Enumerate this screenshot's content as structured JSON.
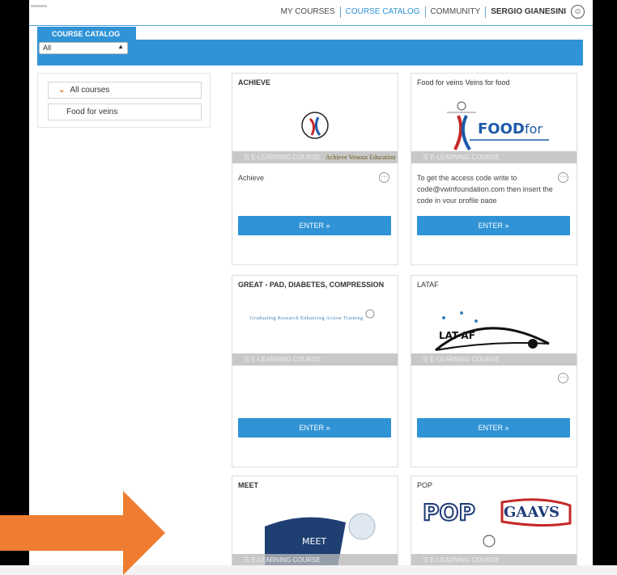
{
  "nav": {
    "links": [
      "MY COURSES",
      "COURSE CATALOG",
      "COMMUNITY"
    ],
    "user": "SERGIO GIANESINI",
    "avatar_glyph": "☺"
  },
  "catalog": {
    "tab_label": "COURSE CATALOG",
    "filter_value": "All"
  },
  "sidebar": {
    "items": [
      {
        "label": "All courses"
      },
      {
        "label": "Food for veins"
      }
    ]
  },
  "cards": [
    {
      "title": "ACHIEVE",
      "bar": "E-LEARNING COURSE",
      "logo_text": "Achieve Venous Education",
      "desc": "Achieve",
      "enter": "ENTER »"
    },
    {
      "title": "Food for veins Veins for food",
      "bar": "E-LEARNING COURSE",
      "logo_text": "FOOD for VEINS",
      "desc": "To get the access code write to code@vwinfoundation.com then insert the code in your profile page",
      "enter": "ENTER »"
    },
    {
      "title": "GREAT - PAD, DIABETES, COMPRESSION",
      "bar": "E-LEARNING COURSE",
      "logo_text": "Graduating Research Enhancing Action Training",
      "desc": "",
      "enter": "ENTER »"
    },
    {
      "title": "LATAF",
      "bar": "E-LEARNING COURSE",
      "logo_text": "LAT-AF",
      "desc": "",
      "enter": "ENTER »"
    },
    {
      "title": "MEET",
      "bar": "E-LEARNING COURSE",
      "logo_text": "MEET",
      "desc": "",
      "enter": ""
    },
    {
      "title": "POP",
      "bar": "E-LEARNING COURSE",
      "logo_text": "POP GAAVS",
      "desc": "",
      "enter": ""
    }
  ],
  "colors": {
    "accent": "#2f93d6",
    "arrow": "#ef7d31",
    "chevron": "#e37d2f"
  }
}
